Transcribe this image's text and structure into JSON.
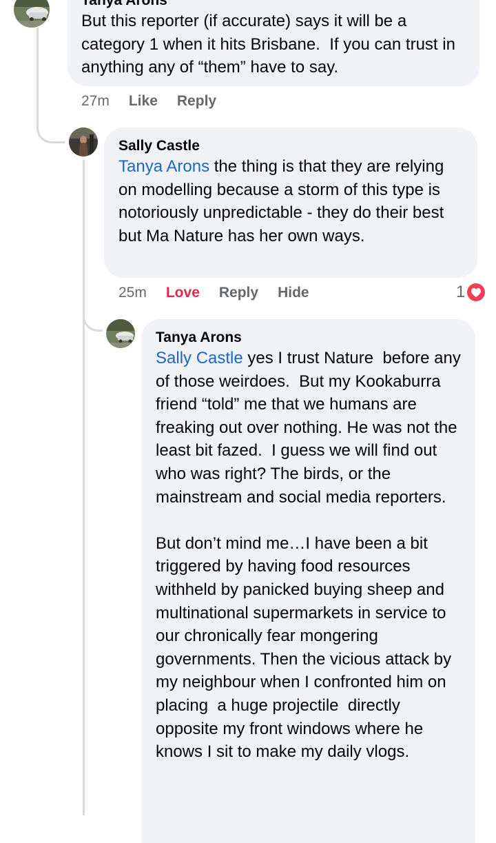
{
  "comments": [
    {
      "author": "Tanya Arons",
      "text": "But this reporter (if accurate) says it will be a category 1 when it hits Brisbane.  If you can trust in anything any of “them” have to say.",
      "time": "27m",
      "like_label": "Like",
      "reply_label": "Reply"
    },
    {
      "author": "Sally Castle",
      "mention": "Tanya Arons",
      "text": " the thing is that they are relying on modelling because a storm of this type is notoriously unpredictable - they do their best but Ma Nature has her own ways.",
      "time": "25m",
      "like_label": "Love",
      "reply_label": "Reply",
      "hide_label": "Hide",
      "reaction_count": "1",
      "reaction_icon": "love-heart-icon"
    },
    {
      "author": "Tanya Arons",
      "mention": "Sally Castle",
      "text": " yes I trust Nature  before any of those weirdoes.  But my Kookaburra friend “told” me that we humans are freaking out over nothing. He was not the least bit fazed.  I guess we will find out who was right? The birds, or the mainstream and social media reporters.\n\nBut don’t mind me…I have been a bit triggered by having food resources withheld by panicked buying sheep and multinational supermarkets in service to our chronically fear mongering governments. Then the vicious attack by my neighbour when I confronted him on placing  a huge projectile  directly opposite my front windows where he knows I sit to make my daily vlogs."
    }
  ],
  "colors": {
    "bubble": "#f0f2f5",
    "mention": "#1b66c9",
    "love": "#e4284e",
    "meta": "#65676b",
    "thread_line": "#d6d9de"
  }
}
